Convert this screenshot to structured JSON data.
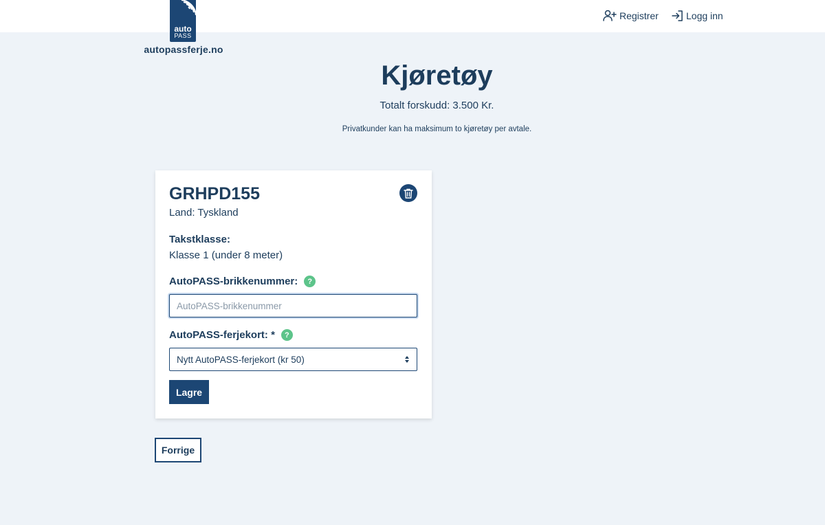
{
  "header": {
    "logo": {
      "badge_top": "auto",
      "badge_bottom": "PASS",
      "site": "autopassferje.no"
    },
    "nav": {
      "register_label": "Registrer",
      "register_icon": "user-plus-icon",
      "login_label": "Logg inn",
      "login_icon": "log-in-icon"
    }
  },
  "main": {
    "title": "Kjøretøy",
    "total": "Totalt forskudd: 3.500 Kr.",
    "info": "Privatkunder kan ha maksimum to kjøretøy per avtale."
  },
  "vehicle": {
    "plate": "GRHPD155",
    "country": "Land: Tyskland",
    "delete_icon": "trash-icon",
    "tariff_label": "Takstklasse:",
    "tariff_value": "Klasse 1 (under 8 meter)",
    "tag_label": "AutoPASS-brikkenummer:",
    "tag_placeholder": "AutoPASS-brikkenummer",
    "tag_value": "",
    "help_symbol": "?",
    "ferry_label": "AutoPASS-ferjekort: *",
    "ferry_selected": "Nytt AutoPASS-ferjekort (kr 50)",
    "save_label": "Lagre"
  },
  "footer": {
    "previous_label": "Forrige"
  },
  "colors": {
    "brand": "#1c4674",
    "text": "#1d3d5c",
    "background": "#eef3f8",
    "help": "#5dc48a"
  }
}
